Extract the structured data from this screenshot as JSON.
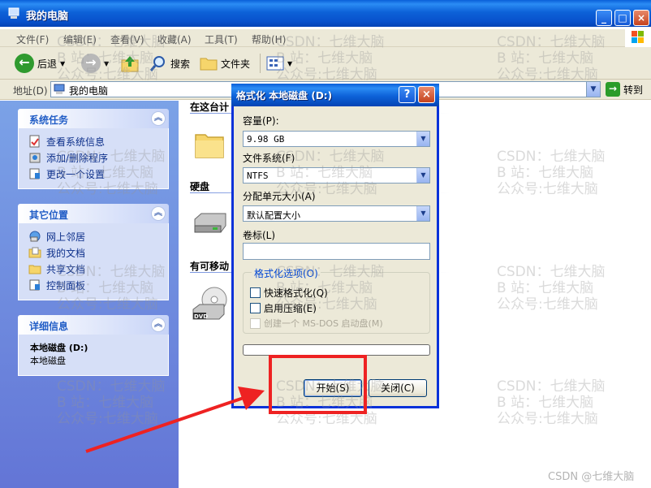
{
  "window": {
    "title": "我的电脑"
  },
  "menu": [
    "文件(F)",
    "编辑(E)",
    "查看(V)",
    "收藏(A)",
    "工具(T)",
    "帮助(H)"
  ],
  "toolbar": {
    "back": "后退",
    "search": "搜索",
    "folders": "文件夹"
  },
  "address": {
    "label": "地址(D)",
    "value": "我的电脑",
    "go": "转到"
  },
  "left_pane": {
    "system_tasks": {
      "title": "系统任务",
      "items": [
        "查看系统信息",
        "添加/删除程序",
        "更改一个设置"
      ]
    },
    "other_places": {
      "title": "其它位置",
      "items": [
        "网上邻居",
        "我的文档",
        "共享文档",
        "控制面板"
      ]
    },
    "details": {
      "title": "详细信息",
      "name": "本地磁盘 (D:)",
      "type": "本地磁盘"
    }
  },
  "content": {
    "sections": [
      "在这台计",
      "硬盘",
      "有可移动"
    ]
  },
  "dialog": {
    "title": "格式化 本地磁盘 (D:)",
    "capacity_label": "容量(P):",
    "capacity_value": "9.98 GB",
    "filesystem_label": "文件系统(F)",
    "filesystem_value": "NTFS",
    "alloc_label": "分配单元大小(A)",
    "alloc_value": "默认配置大小",
    "volume_label": "卷标(L)",
    "volume_value": "",
    "options_title": "格式化选项(O)",
    "opt_quick": "快速格式化(Q)",
    "opt_compress": "启用压缩(E)",
    "opt_msdos": "创建一个 MS-DOS 启动盘(M)",
    "progress": 0,
    "start_button": "开始(S)",
    "close_button": "关闭(C)"
  },
  "watermark": [
    "CSDN：七维大脑",
    "B 站：七维大脑",
    "公众号:七维大脑"
  ],
  "credit": "CSDN @七维大脑",
  "colors": {
    "annotation": "#ee2222",
    "xp_blue": "#0a5fd8",
    "task_pane": "#6f8fe0"
  }
}
